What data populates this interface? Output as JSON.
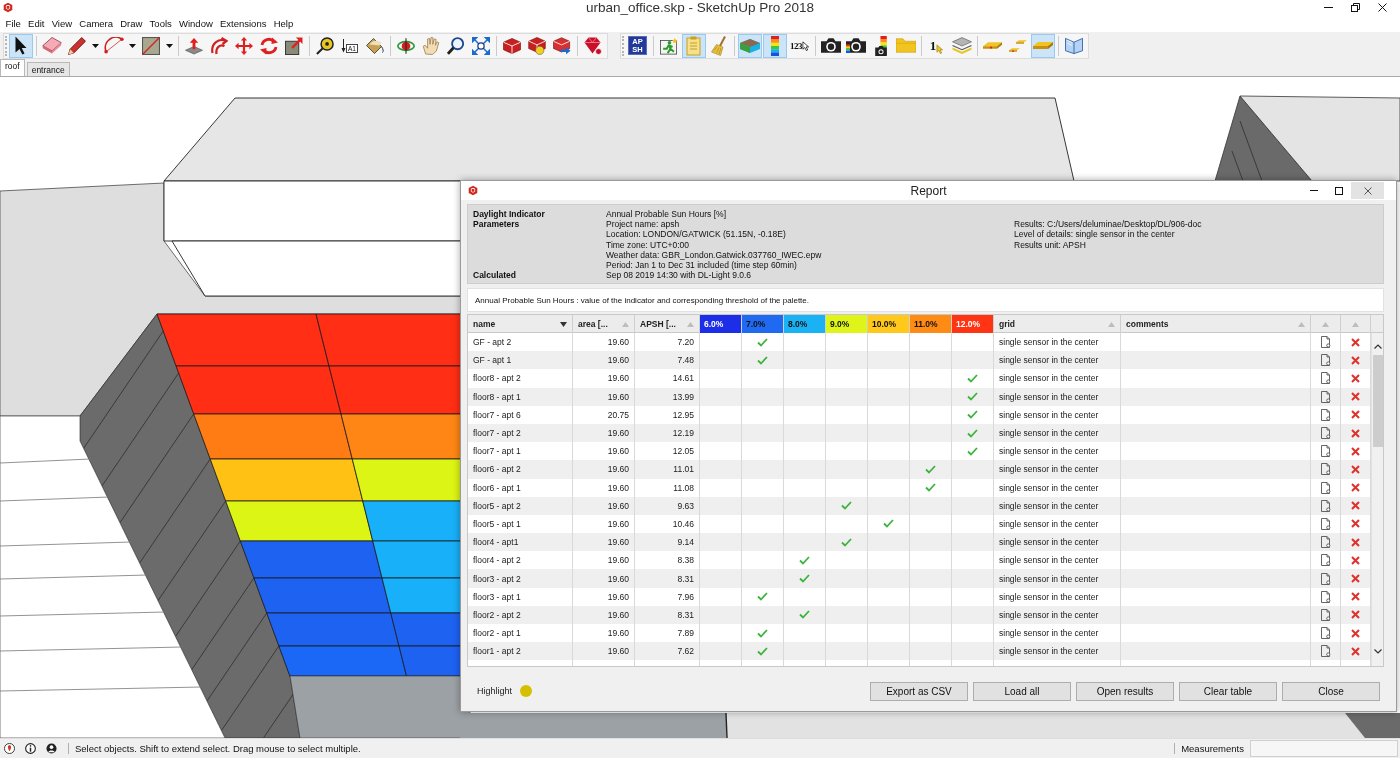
{
  "window": {
    "title": "urban_office.skp - SketchUp Pro 2018"
  },
  "menu": [
    "File",
    "Edit",
    "View",
    "Camera",
    "Draw",
    "Tools",
    "Window",
    "Extensions",
    "Help"
  ],
  "toolbars": [
    {
      "groups": [
        [
          {
            "kind": "tool",
            "on": true
          }
        ],
        [
          {
            "kind": "tool",
            "on": false
          },
          {
            "kind": "tool",
            "on": false
          },
          {
            "kind": "dropdown",
            "on": false
          },
          {
            "kind": "tool",
            "on": false
          },
          {
            "kind": "dropdown",
            "on": false
          },
          {
            "kind": "tool",
            "on": false
          },
          {
            "kind": "dropdown",
            "on": false
          }
        ],
        [
          {
            "kind": "tool",
            "on": false
          },
          {
            "kind": "tool",
            "on": false
          },
          {
            "kind": "tool",
            "on": false
          },
          {
            "kind": "tool",
            "on": false
          },
          {
            "kind": "tool",
            "on": false
          }
        ],
        [
          {
            "kind": "tool",
            "on": false
          },
          {
            "kind": "tool",
            "on": false,
            "text": [
              "A1"
            ]
          },
          {
            "kind": "tool",
            "on": false
          }
        ],
        [
          {
            "kind": "tool",
            "on": false
          },
          {
            "kind": "tool",
            "on": false
          },
          {
            "kind": "tool",
            "on": false
          },
          {
            "kind": "tool",
            "on": false
          }
        ],
        [
          {
            "kind": "tool",
            "on": false
          },
          {
            "kind": "tool",
            "on": false
          },
          {
            "kind": "tool",
            "on": false
          }
        ],
        [
          {
            "kind": "tool",
            "on": false
          }
        ]
      ]
    },
    {
      "groups": [
        [
          {
            "kind": "tool",
            "on": false,
            "text": [
              "AP",
              "SH"
            ]
          }
        ],
        [
          {
            "kind": "tool",
            "on": false
          },
          {
            "kind": "tool",
            "on": true
          },
          {
            "kind": "tool",
            "on": false
          }
        ],
        [
          {
            "kind": "tool",
            "on": true
          },
          {
            "kind": "tool",
            "on": true
          },
          {
            "kind": "tool",
            "on": false,
            "text": [
              "123"
            ]
          }
        ],
        [
          {
            "kind": "tool",
            "on": false
          },
          {
            "kind": "tool",
            "on": false
          },
          {
            "kind": "tool",
            "on": false
          },
          {
            "kind": "tool",
            "on": false
          }
        ],
        [
          {
            "kind": "tool",
            "on": false,
            "text": [
              "1"
            ]
          },
          {
            "kind": "tool",
            "on": false
          }
        ],
        [
          {
            "kind": "tool",
            "on": false
          },
          {
            "kind": "tool",
            "on": false
          },
          {
            "kind": "tool",
            "on": true
          }
        ],
        [
          {
            "kind": "tool",
            "on": false
          }
        ]
      ]
    }
  ],
  "scene_tabs": [
    {
      "label": "roof",
      "selected": true
    },
    {
      "label": "entrance",
      "selected": false
    }
  ],
  "report": {
    "title": "Report",
    "summary": [
      {
        "label": "Daylight Indicator",
        "values": [
          "Annual Probable Sun Hours [%]"
        ]
      },
      {
        "label": "Parameters",
        "values": [
          "Project name: apsh",
          "Location: LONDON/GATWICK (51.15N, -0.18E)",
          "Time zone: UTC+0:00",
          "Weather data: GBR_London.Gatwick.037760_IWEC.epw",
          "Period: Jan 1 to Dec 31 included (time step 60min)"
        ],
        "side": [
          "Results: C:/Users/deluminae/Desktop/DL/906-doc",
          "Level of details: single sensor in the center",
          "Results unit: APSH"
        ]
      },
      {
        "label": "Calculated",
        "values": [
          "Sep 08 2019 14:30 with DL-Light 9.0.6"
        ]
      }
    ],
    "caption": "Annual Probable Sun Hours : value of the indicator and corresponding threshold of the palette.",
    "table": {
      "columns": [
        {
          "label": "name",
          "sorted": true
        },
        {
          "label": "area [...",
          "sorted": false
        },
        {
          "label": "APSH [...",
          "sorted": false
        }
      ],
      "palette": [
        {
          "label": "6.0%",
          "color": "#1c2ee8"
        },
        {
          "label": "7.0%",
          "color": "#1f6af0"
        },
        {
          "label": "8.0%",
          "color": "#1ab2f5"
        },
        {
          "label": "9.0%",
          "color": "#dff51a"
        },
        {
          "label": "10.0%",
          "color": "#ffc81a"
        },
        {
          "label": "11.0%",
          "color": "#ff8a14"
        },
        {
          "label": "12.0%",
          "color": "#ff3414"
        }
      ],
      "extra_columns": [
        {
          "label": "grid",
          "sorted": false
        },
        {
          "label": "comments",
          "sorted": false
        }
      ],
      "action_columns": [
        {
          "sorted": false
        },
        {
          "sorted": false
        }
      ],
      "rows": [
        {
          "name": "GF - apt 2",
          "area": "19.60",
          "apsh": "7.20",
          "checks": [
            false,
            true,
            false,
            false,
            false,
            false,
            false
          ],
          "grid": "single sensor in the center"
        },
        {
          "name": "GF - apt 1",
          "area": "19.60",
          "apsh": "7.48",
          "checks": [
            false,
            true,
            false,
            false,
            false,
            false,
            false
          ],
          "grid": "single sensor in the center"
        },
        {
          "name": "floor8 - apt 2",
          "area": "19.60",
          "apsh": "14.61",
          "checks": [
            false,
            false,
            false,
            false,
            false,
            false,
            true
          ],
          "grid": "single sensor in the center"
        },
        {
          "name": "floor8 - apt 1",
          "area": "19.60",
          "apsh": "13.99",
          "checks": [
            false,
            false,
            false,
            false,
            false,
            false,
            true
          ],
          "grid": "single sensor in the center"
        },
        {
          "name": "floor7 - apt 6",
          "area": "20.75",
          "apsh": "12.95",
          "checks": [
            false,
            false,
            false,
            false,
            false,
            false,
            true
          ],
          "grid": "single sensor in the center"
        },
        {
          "name": "floor7 - apt 2",
          "area": "19.60",
          "apsh": "12.19",
          "checks": [
            false,
            false,
            false,
            false,
            false,
            false,
            true
          ],
          "grid": "single sensor in the center"
        },
        {
          "name": "floor7 - apt 1",
          "area": "19.60",
          "apsh": "12.05",
          "checks": [
            false,
            false,
            false,
            false,
            false,
            false,
            true
          ],
          "grid": "single sensor in the center"
        },
        {
          "name": "floor6 - apt 2",
          "area": "19.60",
          "apsh": "11.01",
          "checks": [
            false,
            false,
            false,
            false,
            false,
            true,
            false
          ],
          "grid": "single sensor in the center"
        },
        {
          "name": "floor6 - apt 1",
          "area": "19.60",
          "apsh": "11.08",
          "checks": [
            false,
            false,
            false,
            false,
            false,
            true,
            false
          ],
          "grid": "single sensor in the center"
        },
        {
          "name": "floor5 - apt 2",
          "area": "19.60",
          "apsh": "9.63",
          "checks": [
            false,
            false,
            false,
            true,
            false,
            false,
            false
          ],
          "grid": "single sensor in the center"
        },
        {
          "name": "floor5 - apt 1",
          "area": "19.60",
          "apsh": "10.46",
          "checks": [
            false,
            false,
            false,
            false,
            true,
            false,
            false
          ],
          "grid": "single sensor in the center"
        },
        {
          "name": "floor4 - apt1",
          "area": "19.60",
          "apsh": "9.14",
          "checks": [
            false,
            false,
            false,
            true,
            false,
            false,
            false
          ],
          "grid": "single sensor in the center"
        },
        {
          "name": "floor4 - apt 2",
          "area": "19.60",
          "apsh": "8.38",
          "checks": [
            false,
            false,
            true,
            false,
            false,
            false,
            false
          ],
          "grid": "single sensor in the center"
        },
        {
          "name": "floor3 - apt 2",
          "area": "19.60",
          "apsh": "8.31",
          "checks": [
            false,
            false,
            true,
            false,
            false,
            false,
            false
          ],
          "grid": "single sensor in the center"
        },
        {
          "name": "floor3 - apt 1",
          "area": "19.60",
          "apsh": "7.96",
          "checks": [
            false,
            true,
            false,
            false,
            false,
            false,
            false
          ],
          "grid": "single sensor in the center"
        },
        {
          "name": "floor2 - apt 2",
          "area": "19.60",
          "apsh": "8.31",
          "checks": [
            false,
            false,
            true,
            false,
            false,
            false,
            false
          ],
          "grid": "single sensor in the center"
        },
        {
          "name": "floor2 - apt 1",
          "area": "19.60",
          "apsh": "7.89",
          "checks": [
            false,
            true,
            false,
            false,
            false,
            false,
            false
          ],
          "grid": "single sensor in the center"
        },
        {
          "name": "floor1 - apt 2",
          "area": "19.60",
          "apsh": "7.62",
          "checks": [
            false,
            true,
            false,
            false,
            false,
            false,
            false
          ],
          "grid": "single sensor in the center"
        }
      ]
    },
    "highlight_label": "Highlight",
    "buttons": [
      "Export as CSV",
      "Load all",
      "Open results",
      "Clear table",
      "Close"
    ]
  },
  "status_bar": {
    "hint": "Select objects. Shift to extend select. Drag mouse to select multiple.",
    "measurements_label": "Measurements"
  }
}
